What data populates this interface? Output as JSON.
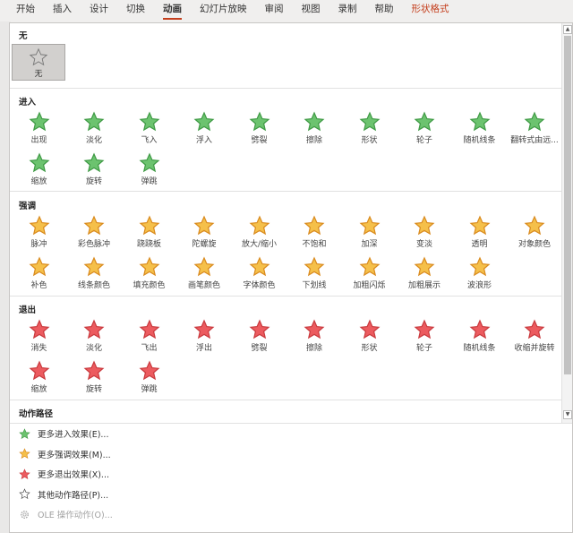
{
  "ribbon_tabs": [
    {
      "label": "开始"
    },
    {
      "label": "插入"
    },
    {
      "label": "设计"
    },
    {
      "label": "切换"
    },
    {
      "label": "动画",
      "active": true
    },
    {
      "label": "幻灯片放映"
    },
    {
      "label": "审阅"
    },
    {
      "label": "视图"
    },
    {
      "label": "录制"
    },
    {
      "label": "帮助"
    },
    {
      "label": "形状格式",
      "contextual": true
    }
  ],
  "colors": {
    "accent": "#c43e1c",
    "entrance": "#6cc36f",
    "emphasis": "#f5c04a",
    "exit": "#ec5b5f"
  },
  "sections": {
    "none": {
      "title": "无",
      "item": "无"
    },
    "entrance": {
      "title": "进入",
      "items": [
        "出现",
        "淡化",
        "飞入",
        "浮入",
        "劈裂",
        "擦除",
        "形状",
        "轮子",
        "随机线条",
        "翻转式由远...",
        "缩放",
        "旋转",
        "弹跳"
      ]
    },
    "emphasis": {
      "title": "强调",
      "items": [
        "脉冲",
        "彩色脉冲",
        "跷跷板",
        "陀螺旋",
        "放大/缩小",
        "不饱和",
        "加深",
        "变淡",
        "透明",
        "对象颜色",
        "补色",
        "线条颜色",
        "填充颜色",
        "画笔颜色",
        "字体颜色",
        "下划线",
        "加粗闪烁",
        "加粗展示",
        "波浪形"
      ]
    },
    "exit": {
      "title": "退出",
      "items": [
        "消失",
        "淡化",
        "飞出",
        "浮出",
        "劈裂",
        "擦除",
        "形状",
        "轮子",
        "随机线条",
        "收缩并旋转",
        "缩放",
        "旋转",
        "弹跳"
      ]
    },
    "motion": {
      "title": "动作路径"
    }
  },
  "menu": [
    {
      "label": "更多进入效果(E)...",
      "icon": "entrance-star-icon",
      "enabled": true
    },
    {
      "label": "更多强调效果(M)...",
      "icon": "emphasis-star-icon",
      "enabled": true
    },
    {
      "label": "更多退出效果(X)...",
      "icon": "exit-star-icon",
      "enabled": true
    },
    {
      "label": "其他动作路径(P)...",
      "icon": "motion-path-star-icon",
      "enabled": true
    },
    {
      "label": "OLE 操作动作(O)...",
      "icon": "gear-icon",
      "enabled": false
    }
  ]
}
